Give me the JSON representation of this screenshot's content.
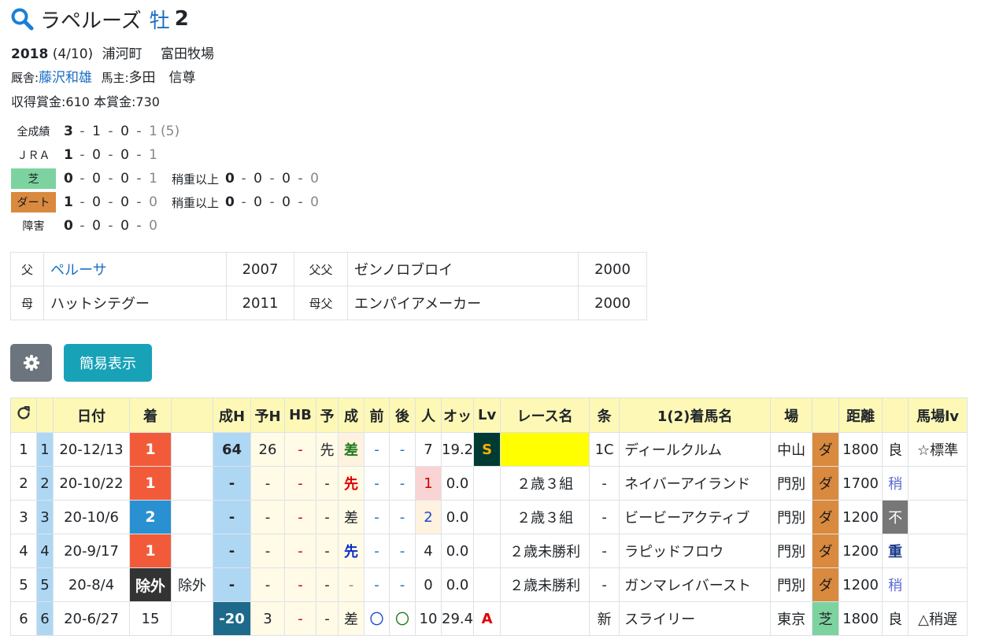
{
  "horse": {
    "name": "ラペルーズ",
    "sex": "牡",
    "age": "2",
    "birth_year": "2018",
    "birth_date": "(4/10)",
    "birthplace": "浦河町",
    "breeder": "富田牧場",
    "stable_label": "厩舎:",
    "trainer": "藤沢和雄",
    "owner_label": "馬主:",
    "owner": "多田　信尊",
    "prize_line": "収得賞金:610  本賞金:730"
  },
  "records": [
    {
      "label": "全成績",
      "style": "plain",
      "nums": [
        "3",
        "1",
        "0",
        "1"
      ],
      "extra": "(5)"
    },
    {
      "label": "ＪＲＡ",
      "style": "plain",
      "nums": [
        "1",
        "0",
        "0",
        "1"
      ]
    },
    {
      "label": "芝",
      "style": "turf",
      "nums": [
        "0",
        "0",
        "0",
        "1"
      ],
      "sub_label": "稍重以上",
      "sub_nums": [
        "0",
        "0",
        "0",
        "0"
      ]
    },
    {
      "label": "ダート",
      "style": "dirt",
      "nums": [
        "1",
        "0",
        "0",
        "0"
      ],
      "sub_label": "稍重以上",
      "sub_nums": [
        "0",
        "0",
        "0",
        "0"
      ]
    },
    {
      "label": "障害",
      "style": "plain",
      "nums": [
        "0",
        "0",
        "0",
        "0"
      ]
    }
  ],
  "pedigree": {
    "sire_label": "父",
    "sire": "ペルーサ",
    "sire_year": "2007",
    "sire_sire_label": "父父",
    "sire_sire": "ゼンノロブロイ",
    "sire_sire_year": "2000",
    "dam_label": "母",
    "dam": "ハットシテグー",
    "dam_year": "2011",
    "dam_sire_label": "母父",
    "dam_sire": "エンパイアメーカー",
    "dam_sire_year": "2000"
  },
  "buttons": {
    "settings_icon": "gear-icon",
    "simple_label": "簡易表示"
  },
  "table": {
    "refresh_icon": "refresh-icon",
    "headers": [
      "",
      "",
      "日付",
      "着",
      "",
      "成H",
      "予H",
      "HB",
      "予",
      "成",
      "前",
      "後",
      "人",
      "オッ",
      "Lv",
      "レース名",
      "条",
      "1(2)着馬名",
      "場",
      "",
      "距離",
      "",
      "馬場lv"
    ],
    "rows": [
      {
        "no": "1",
        "idx": "1",
        "date": "20-12/13",
        "rank": "1",
        "rank_style": "r1",
        "rank_note": "",
        "seiH": "64",
        "seiH_style": "hblue",
        "yoH": "26",
        "hb": "-",
        "yo": "先",
        "sei": "差",
        "sei_style": "cls-sa",
        "mae": "-",
        "ato": "-",
        "pop": "7",
        "pop_style": "",
        "odds": "19.2",
        "lv": "S",
        "lv_style": "lv-s",
        "race": "",
        "race_style": "yel",
        "jou": "1C",
        "winner": "ディールクルム",
        "track": "中山",
        "surface": "ダ",
        "surface_style": "dirt",
        "dist": "1800",
        "cond": "良",
        "cond_style": "",
        "baba": "☆標準"
      },
      {
        "no": "2",
        "idx": "2",
        "date": "20-10/22",
        "rank": "1",
        "rank_style": "r1",
        "rank_note": "",
        "seiH": "-",
        "seiH_style": "hblue",
        "yoH": "-",
        "hb": "-",
        "yo": "-",
        "sei": "先",
        "sei_style": "cls-sen-r",
        "mae": "-",
        "ato": "-",
        "pop": "1",
        "pop_style": "pop-1",
        "odds": "0.0",
        "lv": "",
        "lv_style": "",
        "race": "２歳３組",
        "race_style": "",
        "jou": "-",
        "winner": "ネイバーアイランド",
        "track": "門別",
        "surface": "ダ",
        "surface_style": "dirt",
        "dist": "1700",
        "cond": "稍",
        "cond_style": "cond-soft",
        "baba": ""
      },
      {
        "no": "3",
        "idx": "3",
        "date": "20-10/6",
        "rank": "2",
        "rank_style": "r2",
        "rank_note": "",
        "seiH": "-",
        "seiH_style": "hblue",
        "yoH": "-",
        "hb": "-",
        "yo": "-",
        "sei": "差",
        "sei_style": "",
        "mae": "-",
        "ato": "-",
        "pop": "2",
        "pop_style": "pop-2",
        "odds": "0.0",
        "lv": "",
        "lv_style": "",
        "race": "２歳３組",
        "race_style": "",
        "jou": "-",
        "winner": "ビービーアクティブ",
        "track": "門別",
        "surface": "ダ",
        "surface_style": "dirt",
        "dist": "1200",
        "cond": "不",
        "cond_style": "cond-bad",
        "baba": ""
      },
      {
        "no": "4",
        "idx": "4",
        "date": "20-9/17",
        "rank": "1",
        "rank_style": "r1",
        "rank_note": "",
        "seiH": "-",
        "seiH_style": "hblue",
        "yoH": "-",
        "hb": "-",
        "yo": "-",
        "sei": "先",
        "sei_style": "cls-sen-b",
        "mae": "-",
        "ato": "-",
        "pop": "4",
        "pop_style": "",
        "odds": "0.0",
        "lv": "",
        "lv_style": "",
        "race": "２歳未勝利",
        "race_style": "",
        "jou": "-",
        "winner": "ラピッドフロウ",
        "track": "門別",
        "surface": "ダ",
        "surface_style": "dirt",
        "dist": "1200",
        "cond": "重",
        "cond_style": "cond-heavy",
        "baba": ""
      },
      {
        "no": "5",
        "idx": "5",
        "date": "20-8/4",
        "rank": "除外",
        "rank_style": "rx",
        "rank_note": "除外",
        "seiH": "-",
        "seiH_style": "hblue",
        "yoH": "-",
        "hb": "-",
        "yo": "-",
        "sei": "-",
        "sei_style": "grey",
        "mae": "-",
        "ato": "-",
        "pop": "0",
        "pop_style": "",
        "odds": "0.0",
        "lv": "",
        "lv_style": "",
        "race": "２歳未勝利",
        "race_style": "",
        "jou": "-",
        "winner": "ガンマレイバースト",
        "track": "門別",
        "surface": "ダ",
        "surface_style": "dirt",
        "dist": "1200",
        "cond": "稍",
        "cond_style": "cond-soft",
        "baba": ""
      },
      {
        "no": "6",
        "idx": "6",
        "date": "20-6/27",
        "rank": "15",
        "rank_style": "",
        "rank_note": "",
        "seiH": "-20",
        "seiH_style": "hdark",
        "yoH": "3",
        "hb": "-",
        "yo": "-",
        "sei": "差",
        "sei_style": "",
        "mae": "〇",
        "ato": "〇",
        "pop": "10",
        "pop_style": "",
        "odds": "29.4",
        "lv": "A",
        "lv_style": "lv-a",
        "race": "",
        "race_style": "",
        "jou": "新",
        "winner": "スライリー",
        "track": "東京",
        "surface": "芝",
        "surface_style": "turf",
        "dist": "1800",
        "cond": "良",
        "cond_style": "",
        "baba": "△稍遅"
      }
    ]
  }
}
